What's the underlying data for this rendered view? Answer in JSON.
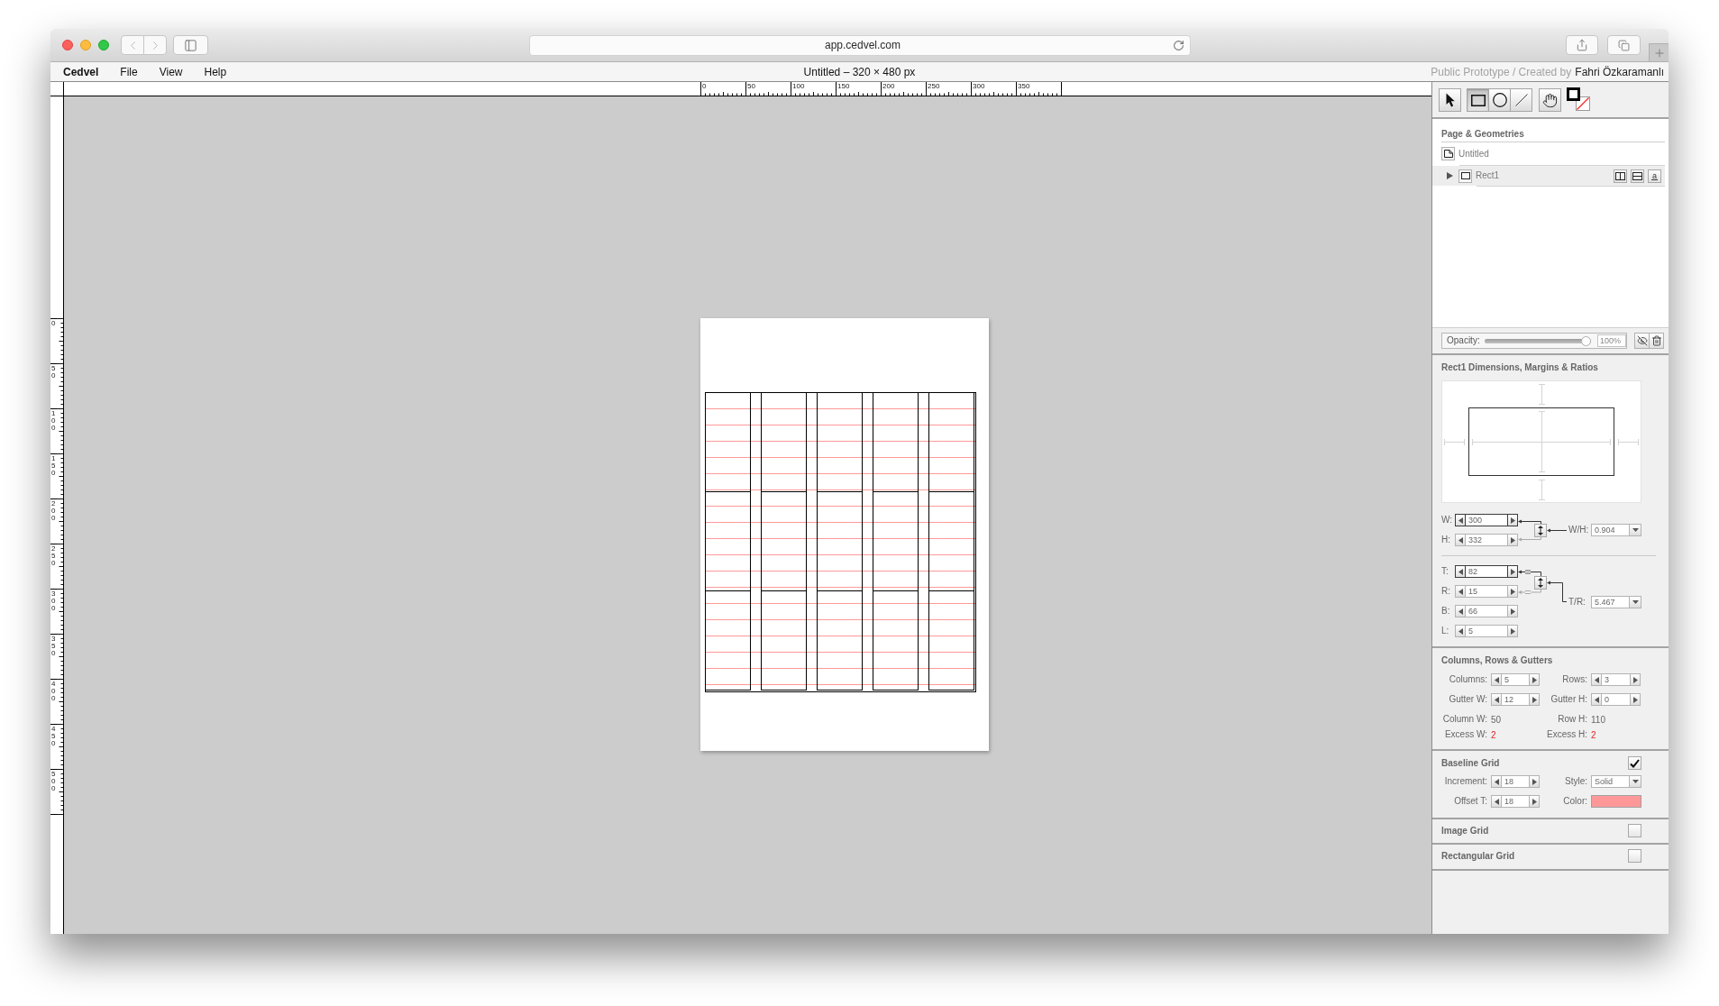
{
  "browser": {
    "url": "app.cedvel.com"
  },
  "menu_bar": {
    "app_name": "Cedvel",
    "menus": [
      "File",
      "View",
      "Help"
    ],
    "document_title": "Untitled – 320 × 480 px",
    "credit": "Public Prototype / Created by",
    "author": "Fahri Özkaramanlı"
  },
  "rulers": {
    "horizontal": [
      "0",
      "50",
      "100",
      "150",
      "200",
      "250",
      "300",
      "350"
    ],
    "vertical": [
      "0",
      "50",
      "100",
      "150",
      "200",
      "250",
      "300",
      "350",
      "400",
      "450",
      "500"
    ]
  },
  "toolbar": {
    "tools": [
      {
        "kind": "pointer",
        "selected": false
      },
      {
        "kind": "rectangle",
        "selected": true
      },
      {
        "kind": "ellipse",
        "selected": false
      },
      {
        "kind": "line",
        "selected": false
      },
      {
        "kind": "hand",
        "selected": false
      }
    ]
  },
  "geometries": {
    "title": "Page & Geometries",
    "items": [
      {
        "label": "Untitled",
        "kind": "page",
        "selected": false,
        "children": [
          {
            "label": "Rect1",
            "kind": "rectangle",
            "selected": true,
            "expanded": false,
            "actions": [
              {
                "kind": "columns"
              },
              {
                "kind": "rows"
              },
              {
                "kind": "baseline",
                "glyph": "a"
              }
            ]
          }
        ]
      }
    ],
    "opacity": {
      "label": "Opacity:",
      "level": 1,
      "value": "100%"
    }
  },
  "dimensions": {
    "title": "Rect1 Dimensions, Margins & Ratios",
    "size_fields": [
      {
        "label": "W:",
        "value": "300",
        "active": true
      },
      {
        "label": "H:",
        "value": "332",
        "active": false
      }
    ],
    "size_ratio": {
      "label": "W/H:",
      "value": "0.904"
    },
    "margin_fields": [
      {
        "label": "T:",
        "value": "82",
        "active": true
      },
      {
        "label": "R:",
        "value": "15",
        "active": false
      },
      {
        "label": "B:",
        "value": "66",
        "active": false
      },
      {
        "label": "L:",
        "value": "5",
        "active": false
      }
    ],
    "margin_ratio": {
      "label": "T/R:",
      "value": "5.467"
    }
  },
  "columns_rows": {
    "title": "Columns, Rows & Gutters",
    "fields": [
      {
        "label": "Columns:",
        "value": "5"
      },
      {
        "label": "Rows:",
        "value": "3"
      },
      {
        "label": "Gutter W:",
        "value": "12"
      },
      {
        "label": "Gutter H:",
        "value": "0"
      }
    ],
    "readouts": [
      {
        "label": "Column W:",
        "value": "50",
        "kind": "plain"
      },
      {
        "label": "Row H:",
        "value": "110",
        "kind": "plain"
      },
      {
        "label": "Excess W:",
        "value": "2",
        "kind": "alert"
      },
      {
        "label": "Excess H:",
        "value": "2",
        "kind": "alert"
      }
    ]
  },
  "baseline_grid": {
    "title": "Baseline Grid",
    "checked": true,
    "increment": {
      "label": "Increment:",
      "value": "18"
    },
    "offset": {
      "label": "Offset T:",
      "value": "18"
    },
    "style": {
      "label": "Style:",
      "value": "Solid"
    },
    "color_label": "Color:",
    "color": "#ff9999"
  },
  "image_grid": {
    "title": "Image Grid",
    "checked": false
  },
  "rectangular_grid": {
    "title": "Rectangular Grid",
    "checked": false
  }
}
